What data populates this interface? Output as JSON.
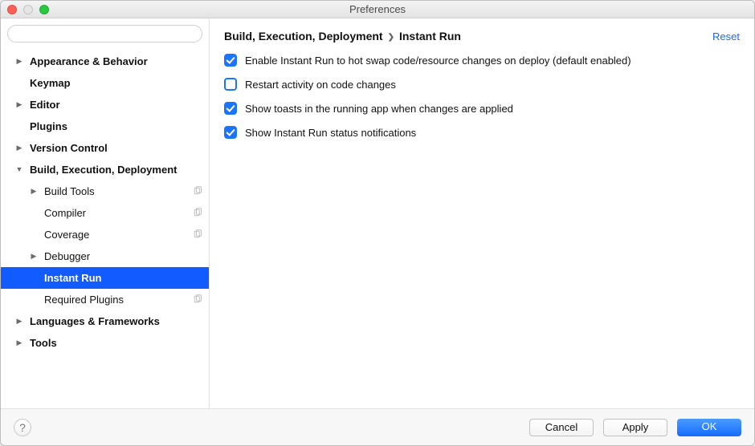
{
  "window": {
    "title": "Preferences"
  },
  "search": {
    "placeholder": ""
  },
  "sidebar": {
    "items": [
      {
        "label": "Appearance & Behavior",
        "depth": 0,
        "arrow": "right",
        "bold": true
      },
      {
        "label": "Keymap",
        "depth": 0,
        "arrow": "",
        "bold": true
      },
      {
        "label": "Editor",
        "depth": 0,
        "arrow": "right",
        "bold": true
      },
      {
        "label": "Plugins",
        "depth": 0,
        "arrow": "",
        "bold": true
      },
      {
        "label": "Version Control",
        "depth": 0,
        "arrow": "right",
        "bold": true
      },
      {
        "label": "Build, Execution, Deployment",
        "depth": 0,
        "arrow": "down",
        "bold": true
      },
      {
        "label": "Build Tools",
        "depth": 1,
        "arrow": "right",
        "bold": false,
        "copy": true
      },
      {
        "label": "Compiler",
        "depth": 1,
        "arrow": "",
        "bold": false,
        "copy": true
      },
      {
        "label": "Coverage",
        "depth": 1,
        "arrow": "",
        "bold": false,
        "copy": true
      },
      {
        "label": "Debugger",
        "depth": 1,
        "arrow": "right",
        "bold": false
      },
      {
        "label": "Instant Run",
        "depth": 1,
        "arrow": "",
        "bold": false,
        "selected": true
      },
      {
        "label": "Required Plugins",
        "depth": 1,
        "arrow": "",
        "bold": false,
        "copy": true
      },
      {
        "label": "Languages & Frameworks",
        "depth": 0,
        "arrow": "right",
        "bold": true
      },
      {
        "label": "Tools",
        "depth": 0,
        "arrow": "right",
        "bold": true
      }
    ]
  },
  "breadcrumb": {
    "parent": "Build, Execution, Deployment",
    "current": "Instant Run"
  },
  "reset_label": "Reset",
  "settings": {
    "options": [
      {
        "label": "Enable Instant Run to hot swap code/resource changes on deploy (default enabled)",
        "checked": true
      },
      {
        "label": "Restart activity on code changes",
        "checked": false
      },
      {
        "label": "Show toasts in the running app when changes are applied",
        "checked": true
      },
      {
        "label": "Show Instant Run status notifications",
        "checked": true
      }
    ]
  },
  "footer": {
    "cancel": "Cancel",
    "apply": "Apply",
    "ok": "OK"
  }
}
